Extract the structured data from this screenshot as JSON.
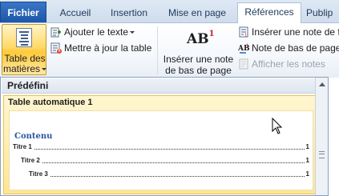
{
  "tabs": {
    "fichier": "Fichier",
    "accueil": "Accueil",
    "insertion": "Insertion",
    "mise_en_page": "Mise en page",
    "references": "Références",
    "publipostage": "Publip"
  },
  "ribbon": {
    "toc_label_line1": "Table des",
    "toc_label_line2": "matières",
    "add_text": "Ajouter le texte",
    "update_table": "Mettre à jour la table",
    "insert_footnote_line1": "Insérer une note",
    "insert_footnote_line2": "de bas de page",
    "insert_endnote": "Insérer une note de f",
    "next_footnote": "Note de bas de page",
    "show_notes": "Afficher les notes",
    "ab_text": "AB",
    "ab_sup": "1"
  },
  "dropdown": {
    "section_header": "Prédéfini",
    "item_title": "Table automatique 1",
    "preview": {
      "heading": "Contenu",
      "entries": [
        {
          "label": "Titre 1",
          "page": "1"
        },
        {
          "label": "Titre 2",
          "page": "1"
        },
        {
          "label": "Titre 3",
          "page": "1"
        }
      ]
    }
  },
  "colors": {
    "accent_file_tab": "#1c56a9",
    "highlight_gallery": "#ffe696",
    "contenu_heading": "#26569e"
  },
  "icons": [
    "document-toc-icon",
    "add-text-icon",
    "update-table-icon",
    "footnote-icon",
    "endnote-icon",
    "next-footnote-icon",
    "show-notes-icon",
    "mouse-cursor-icon"
  ]
}
